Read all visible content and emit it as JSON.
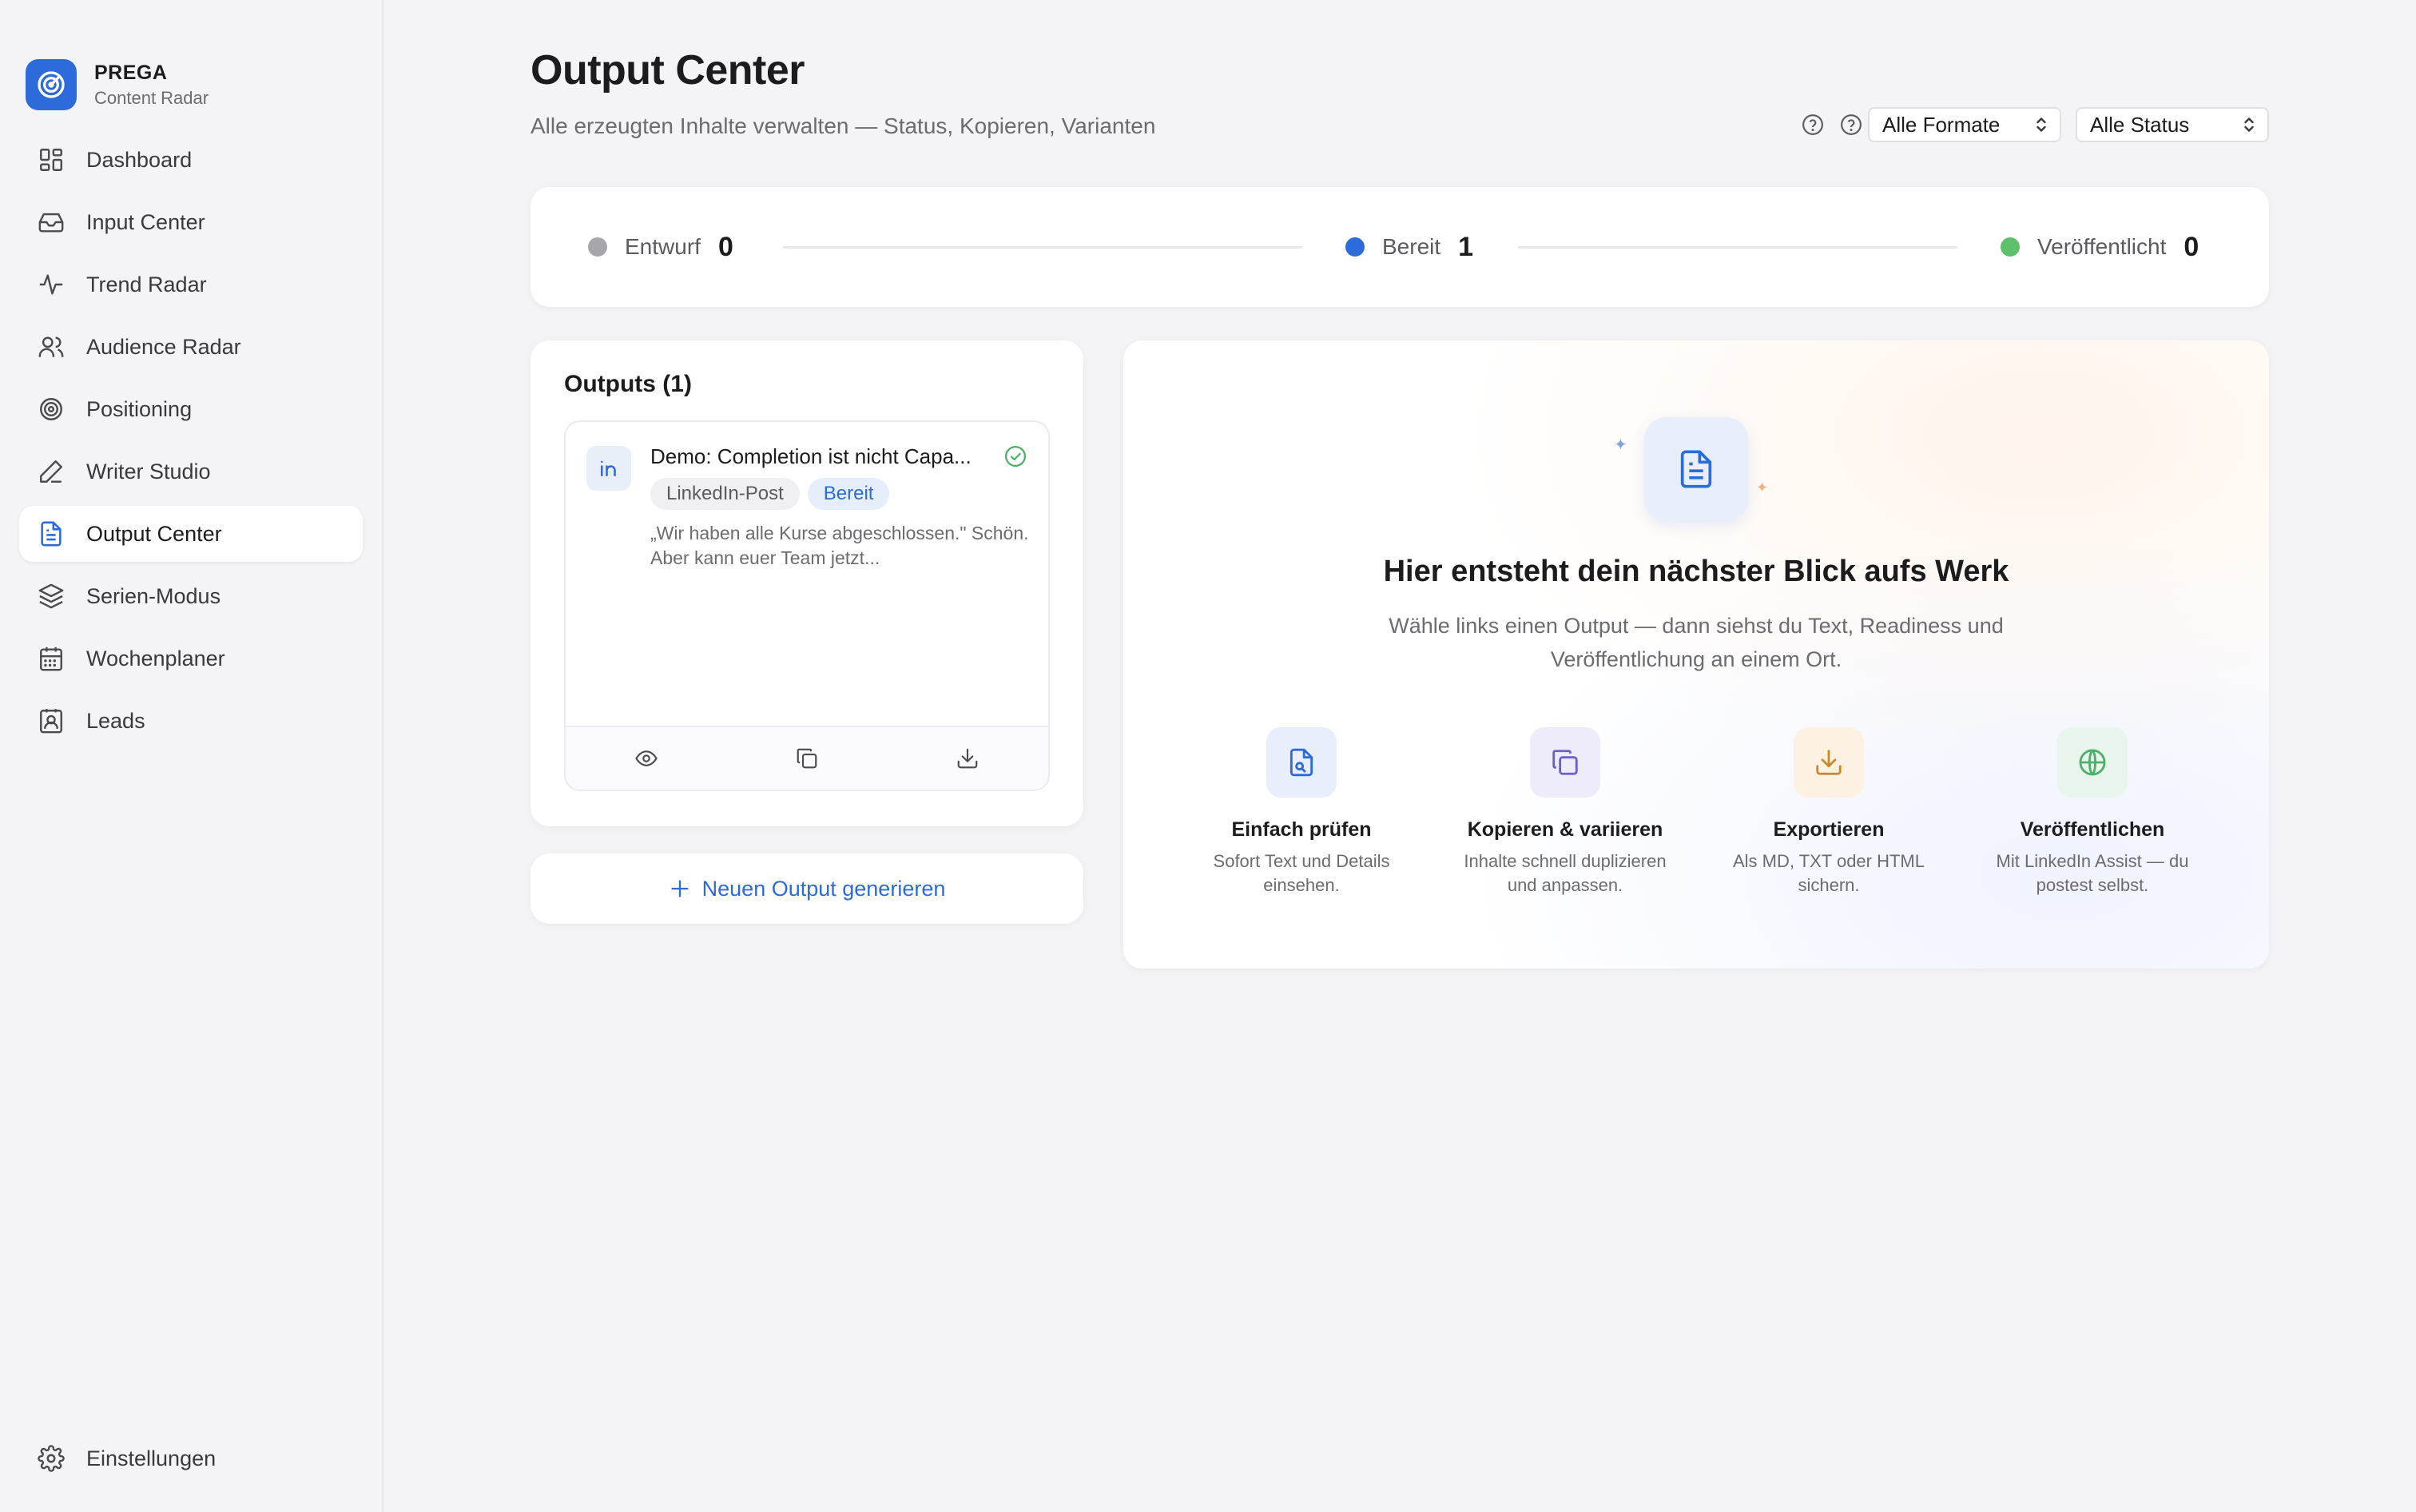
{
  "brand": {
    "name": "PREGA",
    "subtitle": "Content Radar"
  },
  "sidebar": {
    "items": [
      {
        "label": "Dashboard",
        "icon": "dashboard-icon"
      },
      {
        "label": "Input Center",
        "icon": "inbox-icon"
      },
      {
        "label": "Trend Radar",
        "icon": "activity-icon"
      },
      {
        "label": "Audience Radar",
        "icon": "users-icon"
      },
      {
        "label": "Positioning",
        "icon": "target-icon"
      },
      {
        "label": "Writer Studio",
        "icon": "pen-icon"
      },
      {
        "label": "Output Center",
        "icon": "file-text-icon",
        "active": true
      },
      {
        "label": "Serien-Modus",
        "icon": "layers-icon"
      },
      {
        "label": "Wochenplaner",
        "icon": "calendar-icon"
      },
      {
        "label": "Leads",
        "icon": "contact-icon"
      }
    ],
    "settings": {
      "label": "Einstellungen",
      "icon": "gear-icon"
    }
  },
  "header": {
    "title": "Output Center",
    "subtitle": "Alle erzeugten Inhalte verwalten — Status, Kopieren, Varianten"
  },
  "filters": {
    "format": {
      "selected": "Alle Formate"
    },
    "status": {
      "selected": "Alle Status"
    }
  },
  "status_summary": [
    {
      "label": "Entwurf",
      "count": "0",
      "color": "#a7a7ab"
    },
    {
      "label": "Bereit",
      "count": "1",
      "color": "#2c6bd9"
    },
    {
      "label": "Veröffentlicht",
      "count": "0",
      "color": "#5cc16a"
    }
  ],
  "outputs": {
    "title": "Outputs (1)",
    "items": [
      {
        "title": "Demo: Completion ist nicht Capa...",
        "format": "LinkedIn-Post",
        "status": "Bereit",
        "excerpt": "„Wir haben alle Kurse abgeschlossen.\" Schön. Aber kann euer Team jetzt...",
        "icon": "linkedin-icon"
      }
    ],
    "new_button": "Neuen Output generieren"
  },
  "empty_state": {
    "title": "Hier entsteht dein nächster Blick aufs Werk",
    "description": "Wähle links einen Output — dann siehst du Text, Readiness und Veröffentlichung an einem Ort.",
    "features": [
      {
        "title": "Einfach prüfen",
        "description": "Sofort Text und Details einsehen.",
        "icon": "file-search-icon",
        "color": "#2c6bd9",
        "bg": "#e8eefb"
      },
      {
        "title": "Kopieren & variieren",
        "description": "Inhalte schnell duplizieren und anpassen.",
        "icon": "copy-icon",
        "color": "#6b5fd0",
        "bg": "#eeecfa"
      },
      {
        "title": "Exportieren",
        "description": "Als MD, TXT oder HTML sichern.",
        "icon": "download-icon",
        "color": "#c98a2e",
        "bg": "#fdf1e4"
      },
      {
        "title": "Veröffentlichen",
        "description": "Mit LinkedIn Assist — du postest selbst.",
        "icon": "globe-icon",
        "color": "#4caf6a",
        "bg": "#e8f5ec"
      }
    ]
  }
}
